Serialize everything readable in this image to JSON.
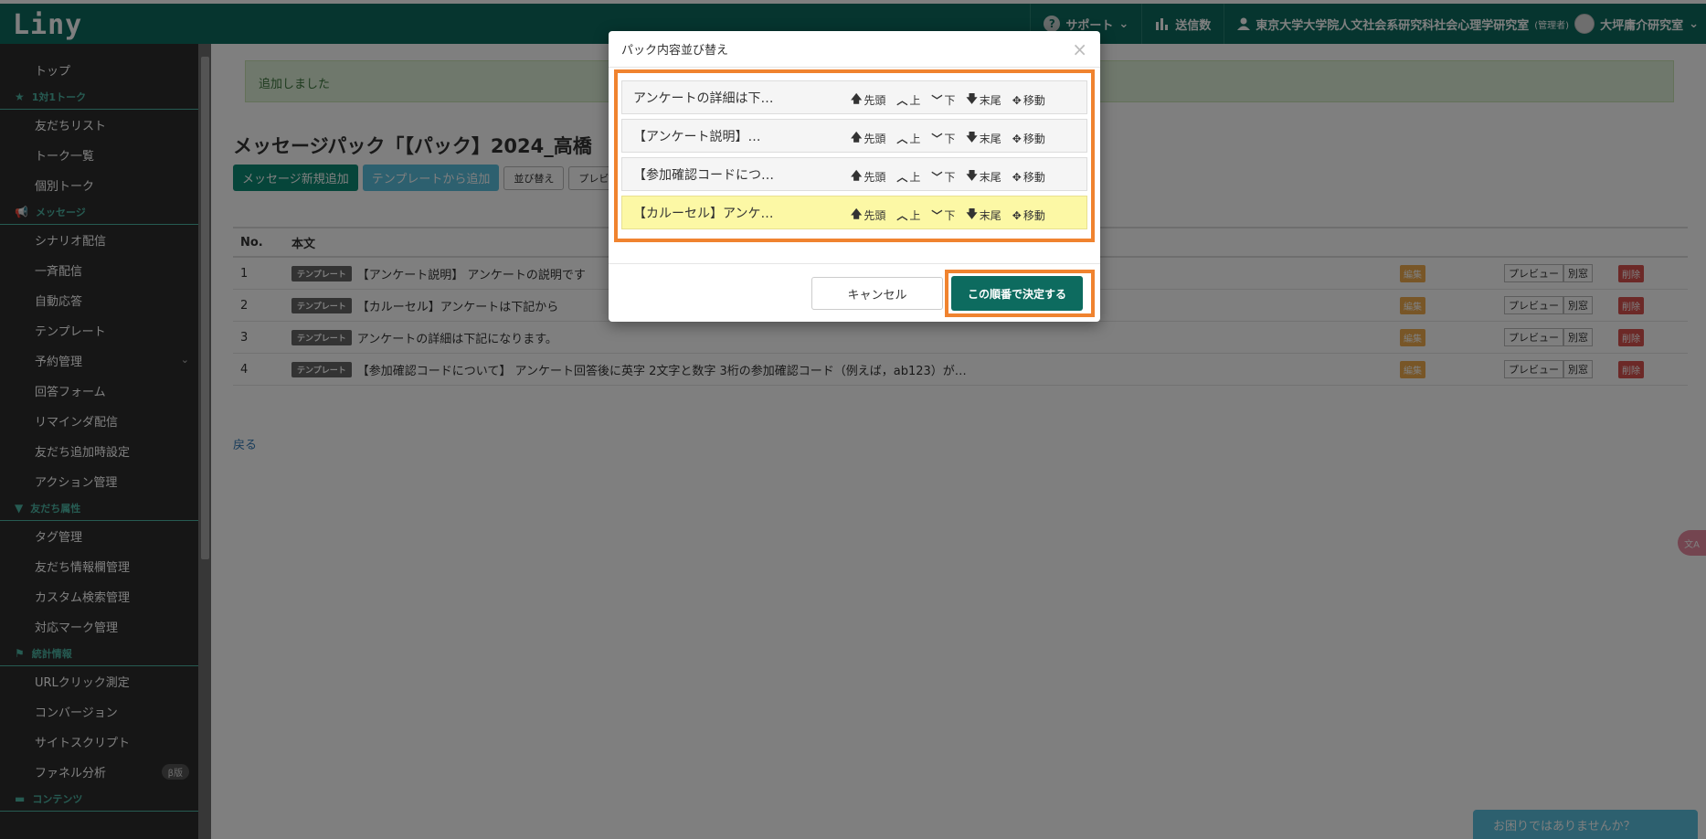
{
  "app": {
    "logo": "Liny"
  },
  "topnav": {
    "support": "サポート",
    "send_count": "送信数",
    "org": "東京大学大学院人文社会系研究科社会心理学研究室",
    "role": "(管理者)",
    "user": "大坪庸介研究室"
  },
  "sidebar": {
    "items": [
      {
        "type": "item",
        "label": "トップ"
      },
      {
        "type": "head",
        "label": "1対1トーク",
        "icon": "star-icon"
      },
      {
        "type": "item",
        "label": "友だちリスト"
      },
      {
        "type": "item",
        "label": "トーク一覧"
      },
      {
        "type": "item",
        "label": "個別トーク"
      },
      {
        "type": "head",
        "label": "メッセージ",
        "icon": "megaphone-icon"
      },
      {
        "type": "item",
        "label": "シナリオ配信"
      },
      {
        "type": "item",
        "label": "一斉配信"
      },
      {
        "type": "item",
        "label": "自動応答"
      },
      {
        "type": "item",
        "label": "テンプレート"
      },
      {
        "type": "item",
        "label": "予約管理"
      },
      {
        "type": "item",
        "label": "回答フォーム"
      },
      {
        "type": "item",
        "label": "リマインダ配信"
      },
      {
        "type": "item",
        "label": "友だち追加時設定"
      },
      {
        "type": "item",
        "label": "アクション管理"
      },
      {
        "type": "head",
        "label": "友だち属性",
        "icon": "filter-icon"
      },
      {
        "type": "item",
        "label": "タグ管理"
      },
      {
        "type": "item",
        "label": "友だち情報欄管理"
      },
      {
        "type": "item",
        "label": "カスタム検索管理"
      },
      {
        "type": "item",
        "label": "対応マーク管理"
      },
      {
        "type": "head",
        "label": "統計情報",
        "icon": "flag-icon"
      },
      {
        "type": "item",
        "label": "URLクリック測定"
      },
      {
        "type": "item",
        "label": "コンバージョン"
      },
      {
        "type": "item",
        "label": "サイトスクリプト"
      },
      {
        "type": "item",
        "label": "ファネル分析"
      },
      {
        "type": "head",
        "label": "コンテンツ",
        "icon": "folder-icon"
      }
    ],
    "beta_badge": "β版"
  },
  "main": {
    "alert": "追加しました",
    "title": "メッセージパック「【パック】2024_高橋",
    "buttons": {
      "new_message": "メッセージ新規追加",
      "from_template": "テンプレートから追加",
      "reorder": "並び替え",
      "preview": "プレビュー"
    },
    "table": {
      "headers": {
        "no": "No.",
        "body": "本文"
      },
      "tag": "テンプレート",
      "rows": [
        {
          "no": "1",
          "text": "【アンケート説明】 アンケートの説明です"
        },
        {
          "no": "2",
          "text": "【カルーセル】アンケートは下記から"
        },
        {
          "no": "3",
          "text": "アンケートの詳細は下記になります。"
        },
        {
          "no": "4",
          "text": "【参加確認コードについて】 アンケート回答後に英字 2文字と数字 3桁の参加確認コード（例えば，ab123）が…"
        }
      ],
      "actions": {
        "edit": "編集",
        "preview": "プレビュー",
        "window": "別窓",
        "delete": "削除"
      }
    },
    "back": "戻る"
  },
  "modal": {
    "title": "パック内容並び替え",
    "close": "×",
    "items": [
      {
        "text": "アンケートの詳細は下…"
      },
      {
        "text": "【アンケート説明】…"
      },
      {
        "text": "【参加確認コードにつ…"
      },
      {
        "text": "【カルーセル】アンケ…"
      }
    ],
    "actions": {
      "first": "先頭",
      "up": "上",
      "down": "下",
      "last": "末尾",
      "move": "移動"
    },
    "cancel": "キャンセル",
    "confirm": "この順番で決定する"
  },
  "help": {
    "label": "お困りではありませんか？"
  },
  "colors": {
    "brand": "#0d6b5f",
    "highlight": "#f0832f",
    "row_highlight": "#fcf8a5"
  }
}
